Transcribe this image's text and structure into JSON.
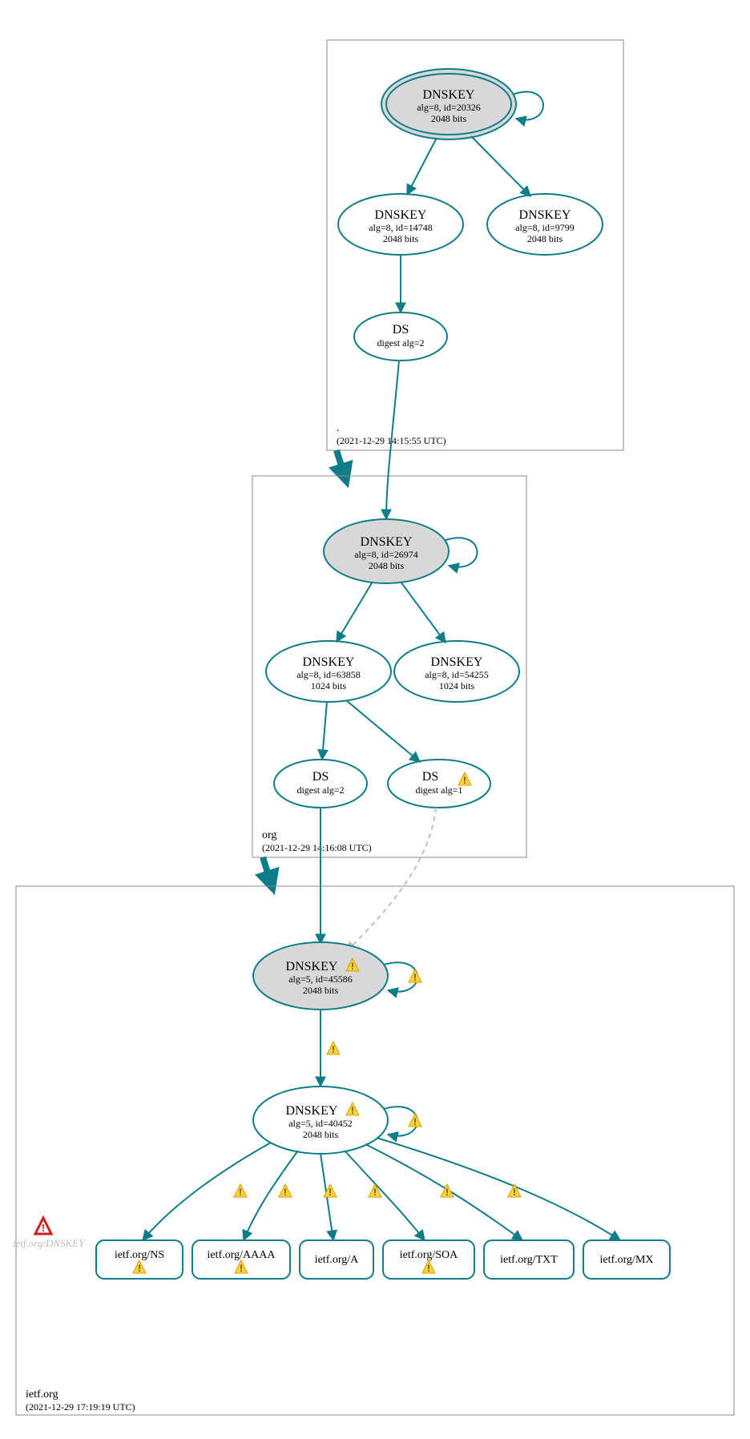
{
  "chart_data": {
    "type": "tree",
    "description": "DNSSEC delegation chain / DNSViz-style authentication graph",
    "zones": [
      {
        "name": ".",
        "timestamp": "(2021-12-29 14:15:55 UTC)",
        "nodes": {
          "root_ksk": {
            "title": "DNSKEY",
            "line2": "alg=8, id=20326",
            "line3": "2048 bits",
            "shaded": true,
            "double_border": true,
            "self_loop": true
          },
          "root_zsk1": {
            "title": "DNSKEY",
            "line2": "alg=8, id=14748",
            "line3": "2048 bits"
          },
          "root_zsk2": {
            "title": "DNSKEY",
            "line2": "alg=8, id=9799",
            "line3": "2048 bits"
          },
          "root_ds": {
            "title": "DS",
            "line2": "digest alg=2"
          }
        }
      },
      {
        "name": "org",
        "timestamp": "(2021-12-29 14:16:08 UTC)",
        "nodes": {
          "org_ksk": {
            "title": "DNSKEY",
            "line2": "alg=8, id=26974",
            "line3": "2048 bits",
            "shaded": true,
            "self_loop": true
          },
          "org_zsk1": {
            "title": "DNSKEY",
            "line2": "alg=8, id=63858",
            "line3": "1024 bits"
          },
          "org_zsk2": {
            "title": "DNSKEY",
            "line2": "alg=8, id=54255",
            "line3": "1024 bits"
          },
          "org_ds1": {
            "title": "DS",
            "line2": "digest alg=2"
          },
          "org_ds2": {
            "title": "DS",
            "line2": "digest alg=1",
            "warn": true
          }
        }
      },
      {
        "name": "ietf.org",
        "timestamp": "(2021-12-29 17:19:19 UTC)",
        "nodes": {
          "ietf_ksk": {
            "title": "DNSKEY",
            "line2": "alg=5, id=45586",
            "line3": "2048 bits",
            "shaded": true,
            "self_loop": true,
            "warn": true,
            "loop_warn": true
          },
          "ietf_zsk": {
            "title": "DNSKEY",
            "line2": "alg=5, id=40452",
            "line3": "2048 bits",
            "self_loop": true,
            "warn": true,
            "loop_warn": true
          }
        },
        "leaves": [
          {
            "label": "ietf.org/NS",
            "warn": true
          },
          {
            "label": "ietf.org/AAAA",
            "warn": true
          },
          {
            "label": "ietf.org/A"
          },
          {
            "label": "ietf.org/SOA",
            "warn": true
          },
          {
            "label": "ietf.org/TXT"
          },
          {
            "label": "ietf.org/MX"
          }
        ],
        "missing": {
          "label": "ietf.org/DNSKEY"
        }
      }
    ],
    "edge_warnings_between": [
      [
        "ietf_ksk",
        "ietf_zsk"
      ],
      [
        "ietf_zsk",
        "leaf0"
      ],
      [
        "ietf_zsk",
        "leaf1"
      ],
      [
        "ietf_zsk",
        "leaf2"
      ],
      [
        "ietf_zsk",
        "leaf3"
      ],
      [
        "ietf_zsk",
        "leaf4"
      ],
      [
        "ietf_zsk",
        "leaf5"
      ]
    ]
  },
  "colors": {
    "teal": "#0f7c8a",
    "shade": "#d8d8d8",
    "gray_edge": "#bfbfbf",
    "warn_fill": "#ffd23f",
    "warn_stroke": "#d89e00",
    "err": "#cc2020"
  }
}
